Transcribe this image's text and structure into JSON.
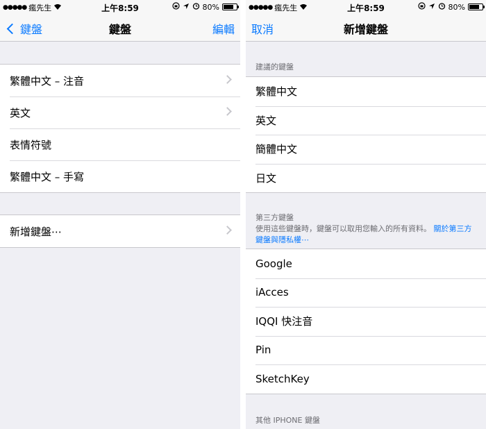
{
  "status": {
    "carrier": "瘋先生",
    "time": "上午8:59",
    "battery": "80%",
    "battery_level": 0.8
  },
  "left": {
    "nav": {
      "back_label": "鍵盤",
      "title": "鍵盤",
      "edit_label": "編輯"
    },
    "keyboards": [
      {
        "label": "繁體中文 – 注音",
        "chevron": true
      },
      {
        "label": "英文",
        "chevron": true
      },
      {
        "label": "表情符號",
        "chevron": false
      },
      {
        "label": "繁體中文 – 手寫",
        "chevron": false
      }
    ],
    "add_keyboard": "新增鍵盤⋯"
  },
  "right": {
    "nav": {
      "cancel_label": "取消",
      "title": "新增鍵盤"
    },
    "suggested_header": "建議的鍵盤",
    "suggested": [
      "繁體中文",
      "英文",
      "簡體中文",
      "日文"
    ],
    "third_party_header": "第三方鍵盤",
    "third_party_desc": "使用這些鍵盤時，鍵盤可以取用您輸入的所有資料。",
    "third_party_link": "關於第三方鍵盤與隱私權⋯",
    "third_party": [
      "Google",
      "iAcces",
      "IQQI 快注音",
      "Pin",
      "SketchKey"
    ],
    "other_header": "其他 IPHONE 鍵盤"
  },
  "colors": {
    "accent": "#0a7aff",
    "background": "#efeff4",
    "separator": "#c8c7cc"
  }
}
